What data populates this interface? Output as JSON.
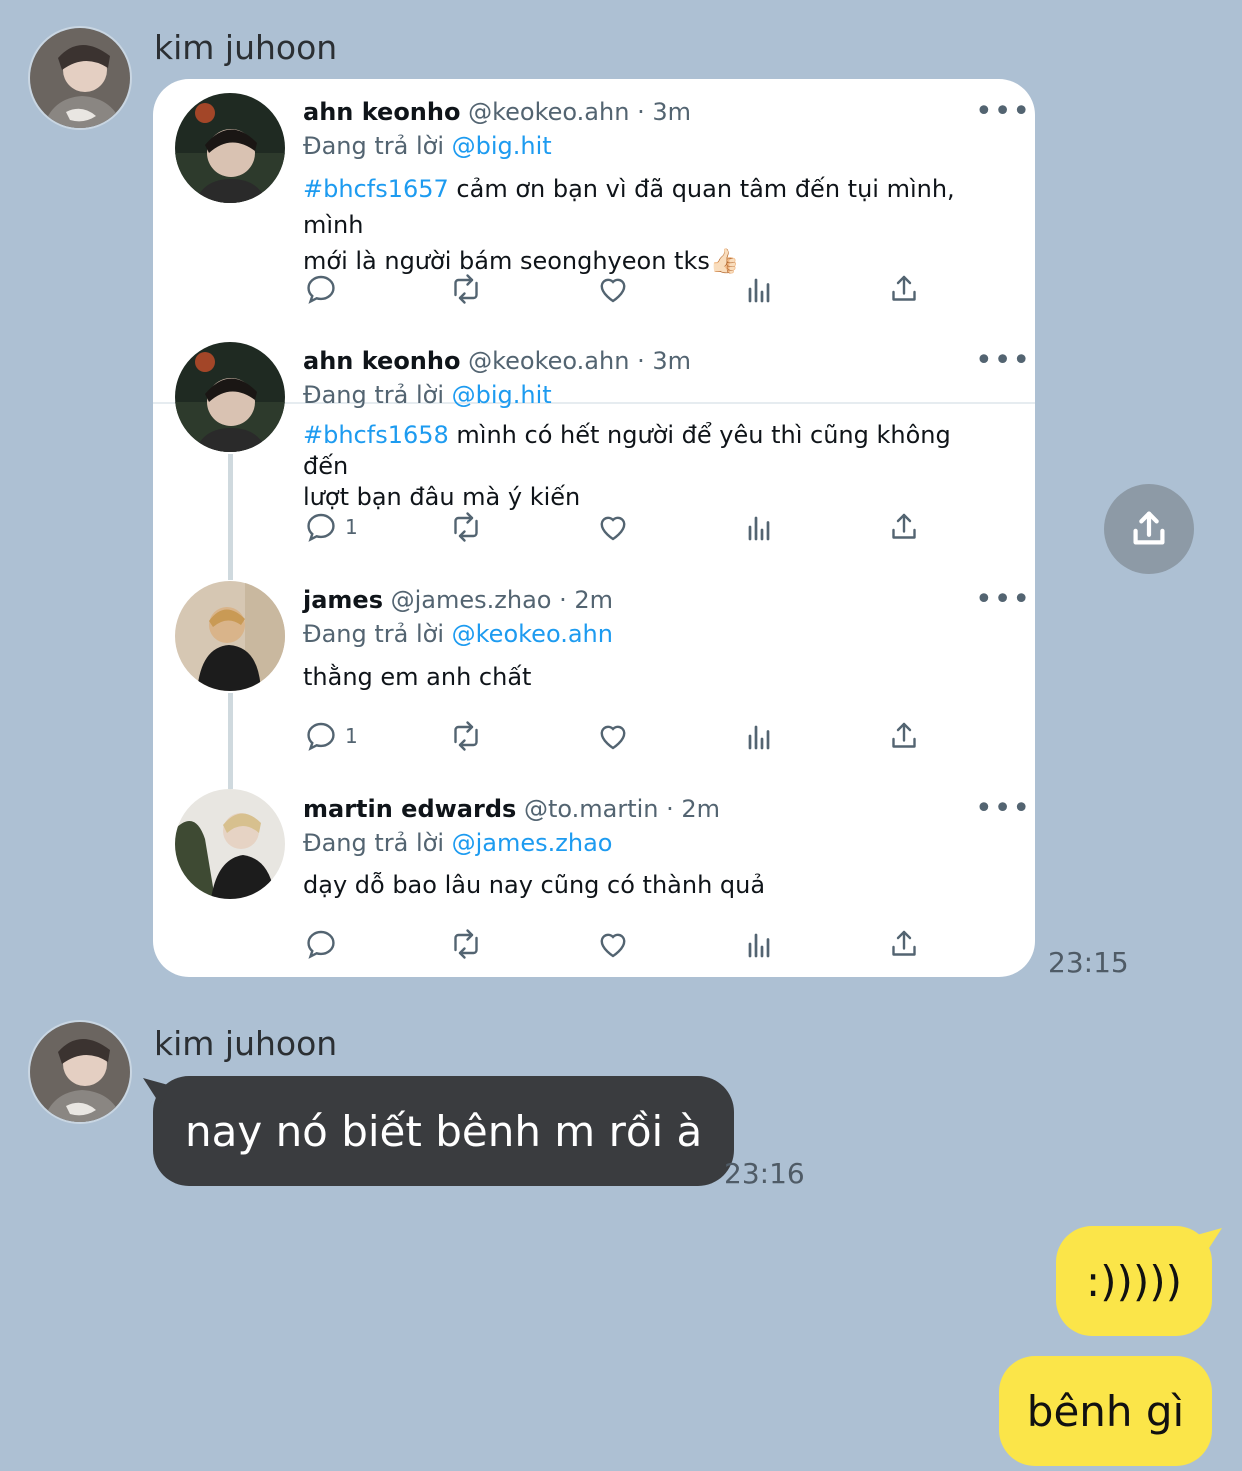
{
  "chat": {
    "background": "#adc0d3",
    "messages": [
      {
        "sender": "kim juhoon",
        "time": "23:15",
        "type": "tweet-screenshot"
      },
      {
        "sender": "kim juhoon",
        "time": "23:16",
        "text": "nay nó biết bênh m rồi à"
      }
    ],
    "my_messages": [
      {
        "text": ":)))))"
      },
      {
        "text": "bênh gì"
      }
    ],
    "share_button_icon": "share-icon"
  },
  "tweets": [
    {
      "name": "ahn keonho",
      "handle": "@keokeo.ahn",
      "sep": " · ",
      "age": "3m",
      "reply_prefix": "Đang trả lời ",
      "reply_to": "@big.hit",
      "hashtag": "#bhcfs1657",
      "text_line1": " cảm ơn bạn vì đã quan tâm đến tụi mình, mình",
      "text_line2": "mới là người bám seonghyeon tks👍🏻",
      "reply_count": ""
    },
    {
      "name": "ahn keonho",
      "handle": "@keokeo.ahn",
      "sep": " · ",
      "age": "3m",
      "reply_prefix": "Đang trả lời ",
      "reply_to": "@big.hit",
      "hashtag": "#bhcfs1658",
      "text_line1": " mình có hết người để yêu thì cũng không đến",
      "text_line2": "lượt bạn đâu mà ý kiến",
      "reply_count": "1"
    },
    {
      "name": "james",
      "handle": "@james.zhao",
      "sep": " · ",
      "age": "2m",
      "reply_prefix": "Đang trả lời ",
      "reply_to": "@keokeo.ahn",
      "text": "thằng em anh chất",
      "reply_count": "1"
    },
    {
      "name": "martin edwards",
      "handle": "@to.martin",
      "sep": " · ",
      "age": "2m",
      "reply_prefix": "Đang trả lời ",
      "reply_to": "@james.zhao",
      "text": "dạy dỗ bao lâu nay cũng có thành quả",
      "reply_count": ""
    }
  ],
  "more_label": "•••",
  "colors": {
    "link": "#1d9bf0",
    "dark_bubble": "#3a3c3f",
    "yellow_bubble": "#fbe549"
  }
}
